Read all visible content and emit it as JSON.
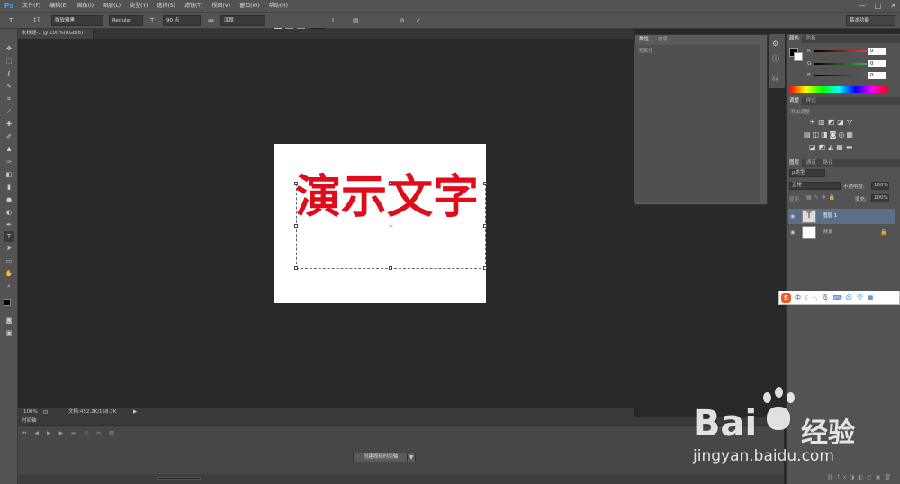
{
  "app": {
    "logo": "Ps"
  },
  "menu": [
    "文件(F)",
    "编辑(E)",
    "图像(I)",
    "图层(L)",
    "类型(Y)",
    "选择(S)",
    "滤镜(T)",
    "视图(V)",
    "窗口(W)",
    "帮助(H)"
  ],
  "window_controls": [
    "—",
    "□",
    "✕"
  ],
  "options": {
    "tool_icon": "T",
    "orient_icon": "↕T",
    "font_family": "微软雅黑",
    "font_style": "Regular",
    "size_icon": "T",
    "font_size": "90 点",
    "aa_icon": "aa",
    "aa_mode": "浑厚",
    "color": "#e00c1a",
    "workspace": "基本功能"
  },
  "document": {
    "tab": "未标题-1 @ 100%(RGB/8)",
    "text": "演示文字",
    "text_color": "#e00c1a"
  },
  "status": {
    "zoom": "100%",
    "doc_info": "文档:452.2K/158.7K",
    "arrow": "▶"
  },
  "timeline": {
    "title": "时间轴",
    "create_button": "创建视频时间轴",
    "arrow": "▼"
  },
  "properties": {
    "tabs": [
      "属性",
      "信息"
    ],
    "empty_text": "无属性"
  },
  "color_panel": {
    "tabs": [
      "颜色",
      "色板"
    ],
    "channels": [
      {
        "label": "R",
        "value": "0",
        "color": "#e84040"
      },
      {
        "label": "G",
        "value": "0",
        "color": "#40b040"
      },
      {
        "label": "B",
        "value": "0",
        "color": "#4060e0"
      }
    ]
  },
  "adjust_panel": {
    "tabs": [
      "调整",
      "样式"
    ],
    "add_label": "添加调整"
  },
  "layers_panel": {
    "tabs": [
      "图层",
      "通道",
      "路径"
    ],
    "blend_mode": "正常",
    "opacity_label": "不透明度:",
    "opacity_value": "100%",
    "lock_label": "锁定:",
    "fill_label": "填充:",
    "fill_value": "100%",
    "layers": [
      {
        "name": "图层 1",
        "thumb": "T"
      },
      {
        "name": "背景",
        "thumb": ""
      }
    ]
  },
  "ime": {
    "logo": "S",
    "lang": "中"
  },
  "watermark": {
    "brand": "Bai",
    "brand2": "经验",
    "url": "jingyan.baidu.com"
  }
}
